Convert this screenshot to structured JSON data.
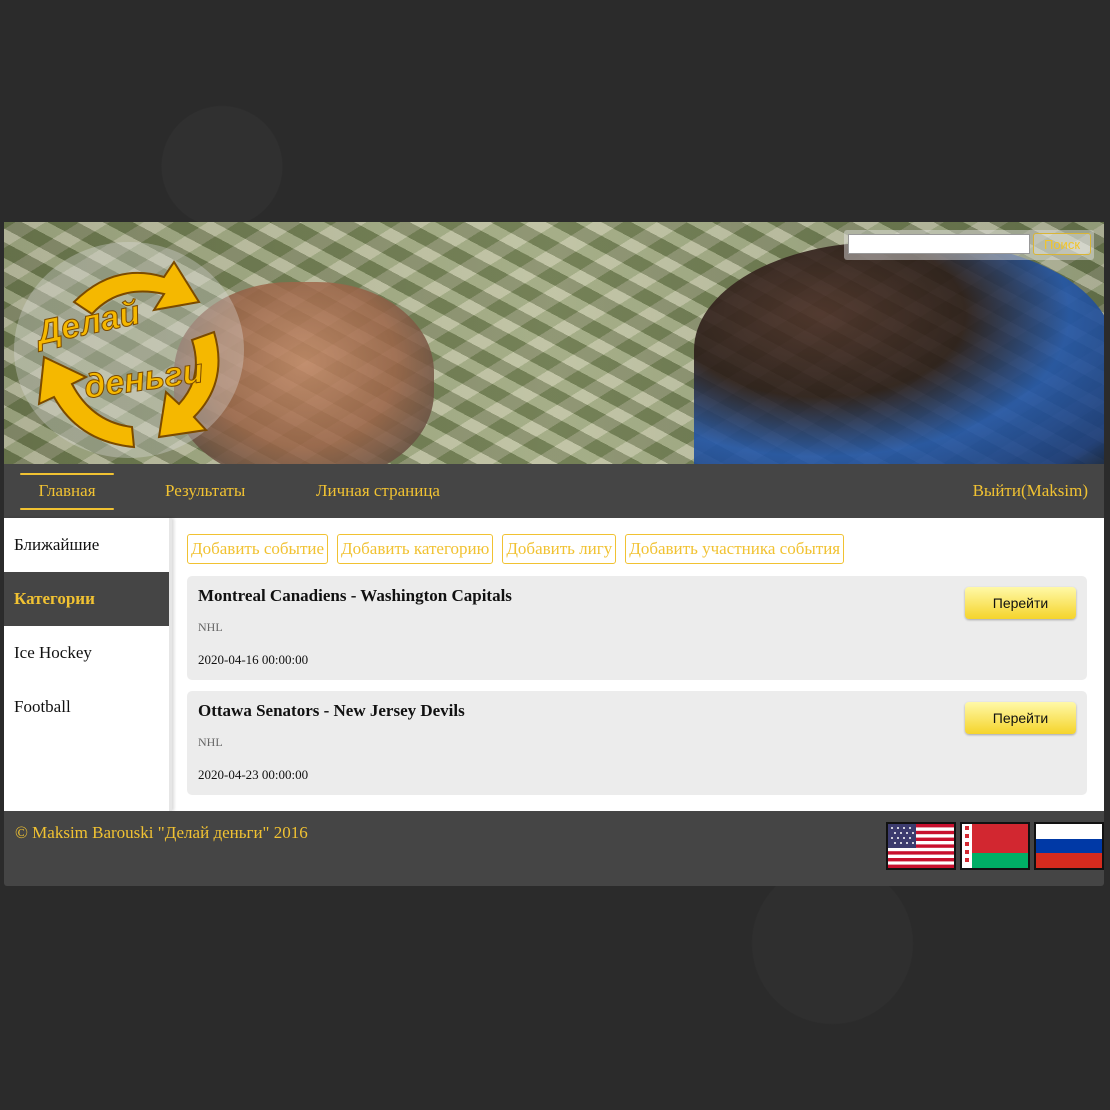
{
  "header": {
    "logo_line1": "Делай",
    "logo_line2": "деньги",
    "search": {
      "placeholder": "",
      "value": "",
      "button_label": "Поиск"
    }
  },
  "nav": {
    "items": [
      {
        "label": "Главная",
        "active": true
      },
      {
        "label": "Результаты"
      },
      {
        "label": "Личная страница"
      }
    ],
    "logout_label": "Выйти(Maksim)"
  },
  "sidebar": {
    "items": [
      {
        "label": "Ближайшие"
      },
      {
        "label": "Категории",
        "highlighted": true
      },
      {
        "label": "Ice Hockey"
      },
      {
        "label": "Football"
      }
    ]
  },
  "actions": [
    {
      "label": "Добавить событие"
    },
    {
      "label": "Добавить категорию"
    },
    {
      "label": "Добавить лигу"
    },
    {
      "label": "Добавить участника события"
    }
  ],
  "events": [
    {
      "title": "Montreal Canadiens - Washington Capitals",
      "league": "NHL",
      "date": "2020-04-16 00:00:00",
      "button_label": "Перейти"
    },
    {
      "title": "Ottawa Senators - New Jersey Devils",
      "league": "NHL",
      "date": "2020-04-23 00:00:00",
      "button_label": "Перейти"
    }
  ],
  "footer": {
    "copyright": "© Maksim Barouski \"Делай деньги\" 2016",
    "flags": [
      {
        "icon": "us-flag-icon"
      },
      {
        "icon": "belarus-flag-icon"
      },
      {
        "icon": "russia-flag-icon"
      }
    ]
  },
  "colors": {
    "accent": "#f1c232",
    "nav_bg": "#454545",
    "page_bg": "#2b2b2b",
    "card_bg": "#ececec",
    "button_gradient": [
      "#fff9a8",
      "#f5d42b"
    ]
  }
}
